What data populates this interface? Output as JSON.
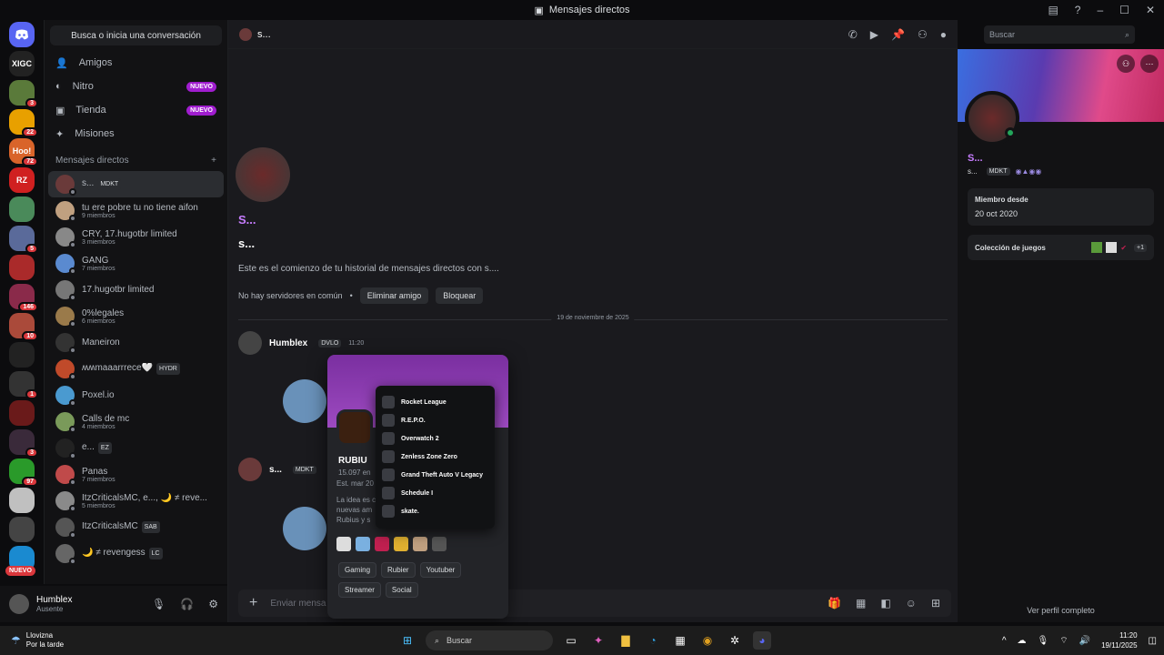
{
  "window": {
    "title": "Mensajes directos"
  },
  "servers": [
    {
      "label": "XIGC",
      "color": "#222",
      "badge": ""
    },
    {
      "label": "",
      "color": "#5a7a3a",
      "badge": "3"
    },
    {
      "label": "",
      "color": "#e8a000",
      "badge": "22"
    },
    {
      "label": "Hoo!",
      "color": "#d9642a",
      "badge": "72"
    },
    {
      "label": "RZ",
      "color": "#d02020",
      "badge": ""
    },
    {
      "label": "",
      "color": "#4a8a5a",
      "badge": ""
    },
    {
      "label": "",
      "color": "#5a6a9a",
      "badge": "5"
    },
    {
      "label": "",
      "color": "#aa2a2a",
      "badge": ""
    },
    {
      "label": "",
      "color": "#8a2a4a",
      "badge": "146"
    },
    {
      "label": "",
      "color": "#aa4a3a",
      "badge": "10"
    },
    {
      "label": "",
      "color": "#222",
      "badge": ""
    },
    {
      "label": "",
      "color": "#333",
      "badge": "1"
    },
    {
      "label": "",
      "color": "#6a1a1a",
      "badge": ""
    },
    {
      "label": "",
      "color": "#3a2a3a",
      "badge": "3"
    },
    {
      "label": "",
      "color": "#2a9a2a",
      "badge": "97"
    },
    {
      "label": "",
      "color": "#c0c0c0",
      "badge": ""
    },
    {
      "label": "",
      "color": "#444",
      "badge": ""
    },
    {
      "label": "",
      "color": "#1a8ad0",
      "badge": ""
    }
  ],
  "servers_nuevo": "NUEVO",
  "dm_panel": {
    "search": "Busca o inicia una conversación",
    "nav": [
      {
        "label": "Amigos",
        "pill": ""
      },
      {
        "label": "Nitro",
        "pill": "NUEVO"
      },
      {
        "label": "Tienda",
        "pill": "NUEVO"
      },
      {
        "label": "Misiones",
        "pill": ""
      }
    ],
    "header": "Mensajes directos",
    "add": "+",
    "items": [
      {
        "name": "s...",
        "tag": "MDKT",
        "sub": "",
        "color": "#6a3a3a",
        "active": true
      },
      {
        "name": "tu ere pobre tu no tiene aifon",
        "tag": "",
        "sub": "9 miembros",
        "color": "#c0a080",
        "active": false
      },
      {
        "name": "CRY, 17.hugotbr limited",
        "tag": "",
        "sub": "3 miembros",
        "color": "#888",
        "active": false
      },
      {
        "name": "GANG",
        "tag": "",
        "sub": "7 miembros",
        "color": "#5a8ad0",
        "active": false
      },
      {
        "name": "17.hugotbr limited",
        "tag": "",
        "sub": "",
        "color": "#777",
        "active": false
      },
      {
        "name": "0%legales",
        "tag": "",
        "sub": "6 miembros",
        "color": "#9a7a4a",
        "active": false
      },
      {
        "name": "Maneiron",
        "tag": "",
        "sub": "",
        "color": "#333",
        "active": false
      },
      {
        "name": "ʍʍmaaarrrece🤍",
        "tag": "HYDR",
        "sub": "",
        "color": "#c04a2a",
        "active": false
      },
      {
        "name": "Poxel.io",
        "tag": "",
        "sub": "",
        "color": "#4a9ad0",
        "active": false
      },
      {
        "name": "Calls de mc",
        "tag": "",
        "sub": "4 miembros",
        "color": "#7a9a5a",
        "active": false
      },
      {
        "name": "e...",
        "tag": "EZ",
        "sub": "",
        "color": "#222",
        "active": false
      },
      {
        "name": "Panas",
        "tag": "",
        "sub": "7 miembros",
        "color": "#c04a4a",
        "active": false
      },
      {
        "name": "ItzCriticalsMC, e..., 🌙 ≠ reve...",
        "tag": "",
        "sub": "5 miembros",
        "color": "#8a8a8a",
        "active": false
      },
      {
        "name": "ItzCriticalsMC",
        "tag": "SAB",
        "sub": "",
        "color": "#555",
        "active": false
      },
      {
        "name": "🌙 ≠ revengess",
        "tag": "LC",
        "sub": "",
        "color": "#666",
        "active": false
      }
    ]
  },
  "user": {
    "name": "Humblex",
    "status": "Ausente"
  },
  "chat": {
    "title": "s...",
    "title_deco": "S...",
    "dm_title": "s...",
    "intro": "Este es el comienzo de tu historial de mensajes directos con s....",
    "no_servers": "No hay servidores en común",
    "remove_friend": "Eliminar amigo",
    "block": "Bloquear",
    "date_divider": "19 de noviembre de 2025",
    "msg1_author": "Humblex",
    "msg1_tag": "DVLO",
    "msg1_time": "11:20",
    "msg2_author": "s...",
    "msg2_tag": "MDKT",
    "composer_placeholder": "Enviar mensa",
    "search_placeholder": "Buscar"
  },
  "popout": {
    "name": "RUBIU",
    "members": "15.097 en",
    "established": "Est. mar 20",
    "desc1": "La idea es c",
    "desc2": "nuevas am",
    "desc3": "Rubius y s",
    "chips": [
      "Gaming",
      "Rubier",
      "Youtuber",
      "Streamer",
      "Social"
    ]
  },
  "gamelist": [
    "Rocket League",
    "R.E.P.O.",
    "Overwatch 2",
    "Zenless Zone Zero",
    "Grand Theft Auto V Legacy",
    "Schedule I",
    "skate."
  ],
  "profile": {
    "name": "S...",
    "tagline": "s...",
    "tag": "MDKT",
    "member_since_label": "Miembro desde",
    "member_since": "20 oct 2020",
    "games_label": "Colección de juegos",
    "games_more": "+1",
    "view_full": "Ver perfil completo"
  },
  "taskbar": {
    "weather_title": "Llovizna",
    "weather_sub": "Por la tarde",
    "search": "Buscar",
    "time": "11:20",
    "date": "19/11/2025"
  }
}
